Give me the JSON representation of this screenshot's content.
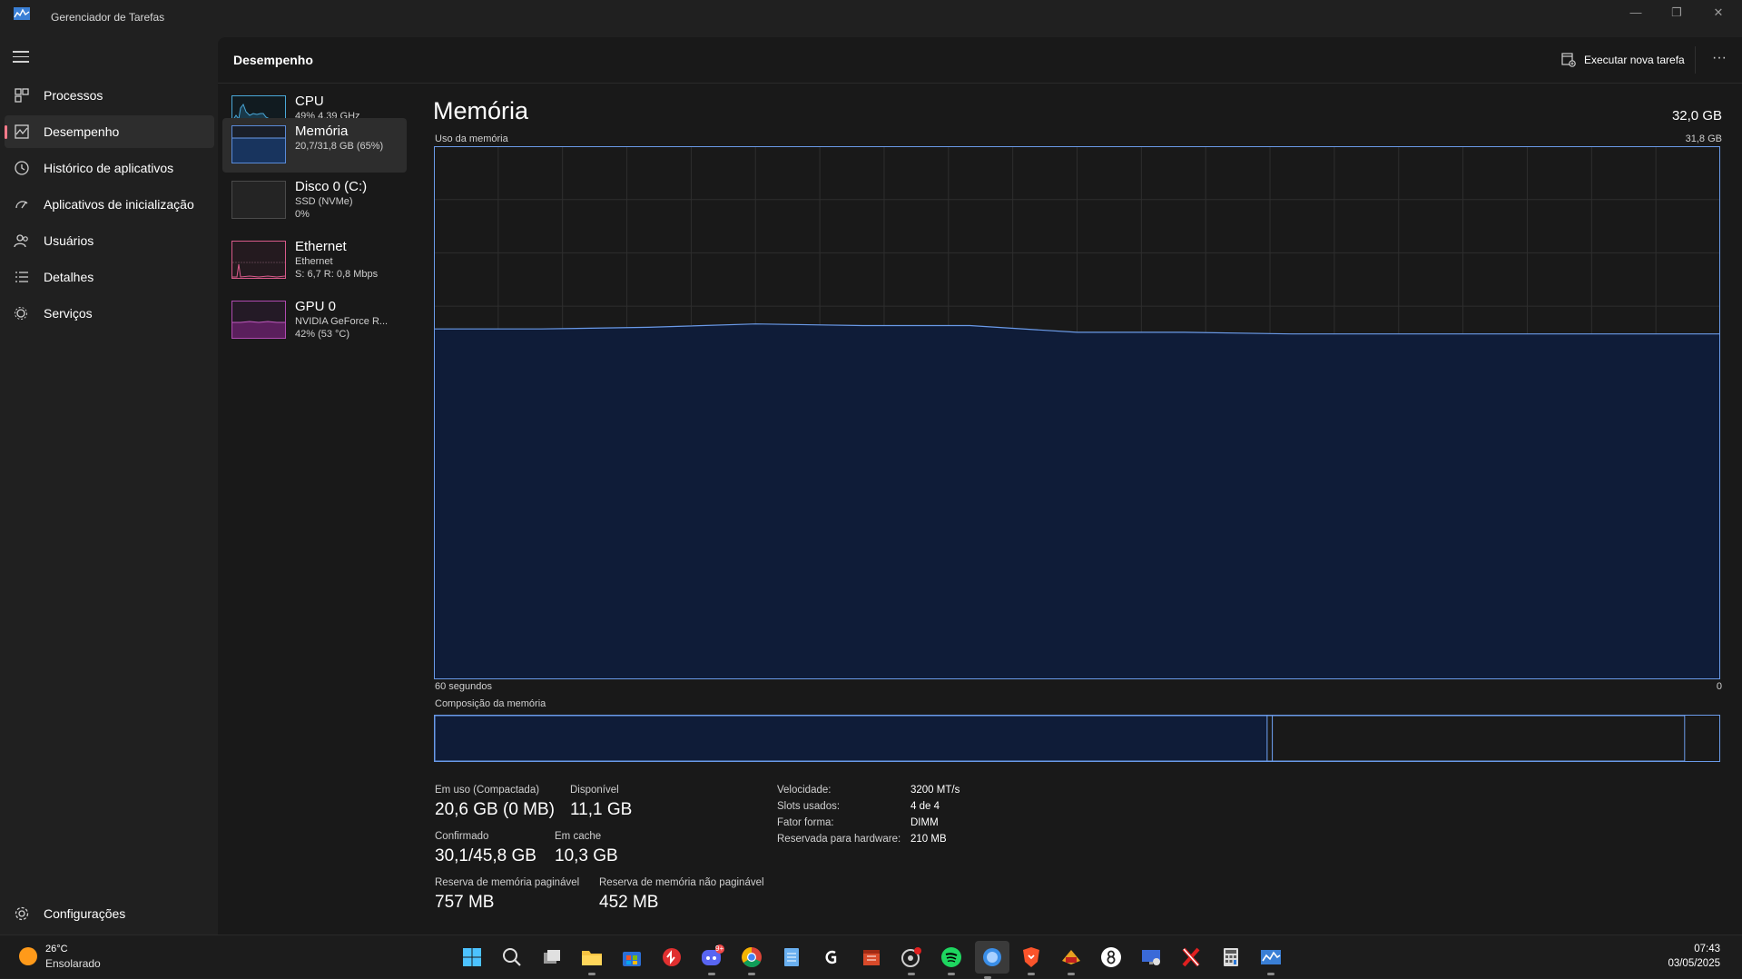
{
  "window": {
    "title": "Gerenciador de Tarefas",
    "controls": {
      "minimize": "—",
      "restore": "❐",
      "close": "✕"
    }
  },
  "nav": {
    "items": [
      {
        "label": "Processos",
        "icon": "processes-icon"
      },
      {
        "label": "Desempenho",
        "icon": "performance-icon"
      },
      {
        "label": "Histórico de aplicativos",
        "icon": "app-history-icon"
      },
      {
        "label": "Aplicativos de inicialização",
        "icon": "startup-apps-icon"
      },
      {
        "label": "Usuários",
        "icon": "users-icon"
      },
      {
        "label": "Detalhes",
        "icon": "details-icon"
      },
      {
        "label": "Serviços",
        "icon": "services-icon"
      }
    ],
    "active_index": 1,
    "settings_label": "Configurações"
  },
  "header": {
    "title": "Desempenho",
    "run_task_label": "Executar nova tarefa",
    "more_label": "···"
  },
  "resources": [
    {
      "name": "CPU",
      "line1": "49% 4,39 GHz",
      "line2": "",
      "color": "#4aa8d8"
    },
    {
      "name": "Memória",
      "line1": "20,7/31,8 GB (65%)",
      "line2": "",
      "color": "#5a8ad8"
    },
    {
      "name": "Disco 0 (C:)",
      "line1": "SSD (NVMe)",
      "line2": "0%",
      "color": "#7ab87a"
    },
    {
      "name": "Ethernet",
      "line1": "Ethernet",
      "line2": "S: 6,7 R: 0,8 Mbps",
      "color": "#d85a8a"
    },
    {
      "name": "GPU 0",
      "line1": "NVIDIA GeForce R...",
      "line2": "42% (53 °C)",
      "color": "#b04ab0"
    }
  ],
  "detail": {
    "title": "Memória",
    "total": "32,0 GB",
    "usage_label": "Uso da memória",
    "usage_max": "31,8 GB",
    "time_left": "60 segundos",
    "time_right": "0",
    "composition_label": "Composição da memória",
    "stats": {
      "in_use_label": "Em uso (Compactada)",
      "in_use_value": "20,6 GB (0 MB)",
      "available_label": "Disponível",
      "available_value": "11,1 GB",
      "committed_label": "Confirmado",
      "committed_value": "30,1/45,8 GB",
      "cached_label": "Em cache",
      "cached_value": "10,3 GB",
      "paged_label": "Reserva de memória paginável",
      "paged_value": "757 MB",
      "nonpaged_label": "Reserva de memória não paginável",
      "nonpaged_value": "452 MB"
    },
    "hardware": [
      {
        "label": "Velocidade:",
        "value": "3200 MT/s"
      },
      {
        "label": "Slots usados:",
        "value": "4 de 4"
      },
      {
        "label": "Fator forma:",
        "value": "DIMM"
      },
      {
        "label": "Reservada para hardware:",
        "value": "210 MB"
      }
    ]
  },
  "chart_data": {
    "type": "area",
    "title": "Uso da memória",
    "x": [
      60,
      55,
      50,
      45,
      40,
      35,
      30,
      25,
      20,
      15,
      10,
      5,
      0
    ],
    "values": [
      20.9,
      20.9,
      21.0,
      21.2,
      21.1,
      21.1,
      20.7,
      20.7,
      20.6,
      20.6,
      20.6,
      20.6,
      20.6
    ],
    "ylim": [
      0,
      31.8
    ],
    "grid": true,
    "colors": {
      "line": "#6a9ae8",
      "fill": "#0f1c38",
      "grid": "#2e2e2e",
      "border": "#6a9ae8"
    }
  },
  "composition": {
    "in_use_fraction": 0.648,
    "modified_fraction": 0.004,
    "standby_fraction": 0.321
  },
  "taskbar": {
    "weather": {
      "temp": "26°C",
      "desc": "Ensolarado"
    },
    "apps": [
      "windows-start-icon",
      "search-icon",
      "task-view-icon",
      "file-explorer-icon",
      "microsoft-store-icon",
      "red-app-icon",
      "discord-icon",
      "chrome-icon",
      "notepad-icon",
      "g-app-icon",
      "calendar-app-icon",
      "red-status-app-icon",
      "spotify-icon",
      "blue-circle-app-icon",
      "brave-icon",
      "game-app-icon",
      "eight-ball-icon",
      "monitor-app-icon",
      "x-app-icon",
      "calculator-icon",
      "task-manager-icon"
    ],
    "discord_badge": "9+",
    "time": "07:43",
    "date": "03/05/2025"
  }
}
